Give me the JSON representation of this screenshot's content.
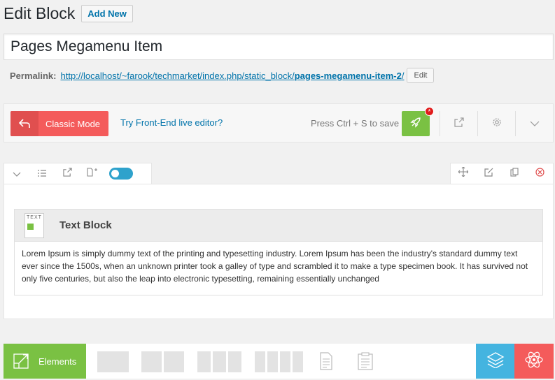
{
  "header": {
    "title": "Edit Block",
    "add_new": "Add New"
  },
  "post_title": {
    "value": "Pages Megamenu Item"
  },
  "permalink": {
    "label": "Permalink:",
    "url_base": "http://localhost/~farook/techmarket/index.php/static_block/",
    "url_slug": "pages-megamenu-item-2",
    "url_tail": "/",
    "edit_label": "Edit"
  },
  "vc_nav": {
    "classic_mode": "Classic Mode",
    "frontend_link": "Try Front-End live editor?",
    "save_hint": "Press Ctrl + S to save",
    "save_badge": "*"
  },
  "text_block": {
    "thumb_label": "TEXT",
    "title": "Text Block",
    "content": "Lorem Ipsum is simply dummy text of the printing and typesetting industry. Lorem Ipsum has been the industry's standard dummy text ever since the 1500s, when an unknown printer took a galley of type and scrambled it to make a type specimen book. It has survived not only five centuries, but also the leap into electronic typesetting, remaining essentially unchanged"
  },
  "bottom_bar": {
    "elements_label": "Elements"
  },
  "colors": {
    "green": "#7ac143",
    "red": "#f45b5b",
    "blue": "#44b4e0",
    "link": "#0073aa"
  }
}
